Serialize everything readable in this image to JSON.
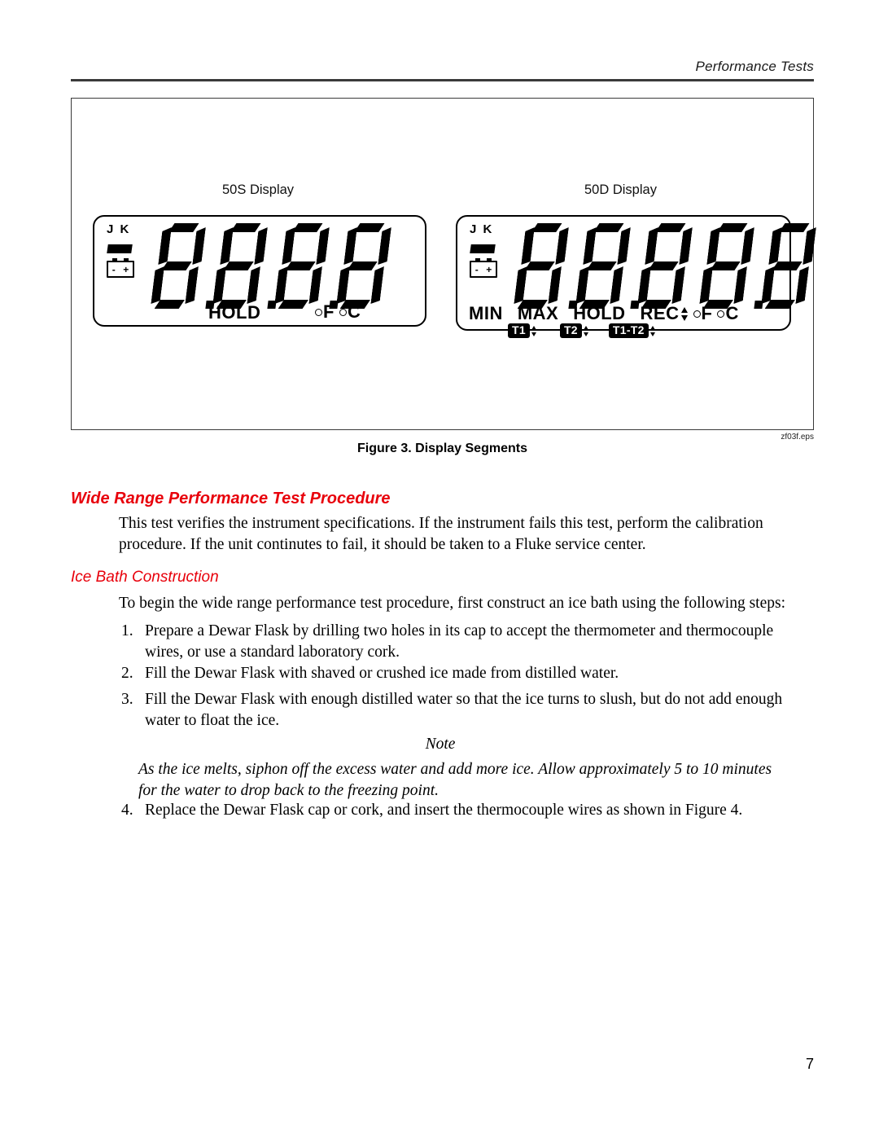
{
  "page": {
    "running_header": "Performance Tests",
    "page_number": "7"
  },
  "figure": {
    "caption": "Figure 3. Display Segments",
    "eps_label": "zf03f.eps",
    "displays": [
      {
        "title": "50S Display",
        "annunciators": {
          "thermocouple_types": "J K",
          "battery_minus": "-",
          "battery_plus": "+"
        },
        "digit_value": "8",
        "bottom_labels": [
          "HOLD"
        ],
        "units": {
          "degree": "°",
          "fahrenheit": "F",
          "celsius": "C"
        }
      },
      {
        "title": "50D Display",
        "annunciators": {
          "thermocouple_types": "J K",
          "battery_minus": "-",
          "battery_plus": "+"
        },
        "digit_value": "8",
        "bottom_labels": [
          "MIN",
          "MAX",
          "HOLD",
          "REC"
        ],
        "channel_badges": [
          "T1",
          "T2",
          "T1-T2"
        ],
        "units": {
          "degree": "°",
          "fahrenheit": "F",
          "celsius": "C"
        }
      }
    ]
  },
  "content": {
    "heading_1": "Wide Range Performance Test Procedure",
    "intro_paragraph": "This test verifies the instrument specifications. If the instrument fails this test, perform the calibration procedure. If the unit continutes to fail, it should be taken to a Fluke service center.",
    "heading_2": "Ice Bath Construction",
    "lead_paragraph": "To begin the wide range performance test procedure, first construct an ice bath using the following steps:",
    "steps": [
      {
        "number": "1.",
        "text": "Prepare a Dewar Flask by drilling two holes in its cap to accept the thermometer and thermocouple wires, or use a standard laboratory cork."
      },
      {
        "number": "2.",
        "text": "Fill the Dewar Flask with shaved or crushed ice made from distilled water."
      },
      {
        "number": "3.",
        "text": "Fill the Dewar Flask with enough distilled water so that the ice turns to slush, but do not add enough water to float the ice."
      },
      {
        "number": "4.",
        "text": "Replace the Dewar Flask cap or cork, and insert the thermocouple wires as shown in Figure 4."
      }
    ],
    "note": {
      "title": "Note",
      "body": "As the ice melts, siphon off the excess water and add more ice. Allow approximately 5 to 10 minutes for the water to drop back to the freezing point."
    }
  },
  "colors": {
    "heading_red": "#e8000b",
    "rule_gray": "#3b3b3b",
    "text_black": "#000000"
  }
}
